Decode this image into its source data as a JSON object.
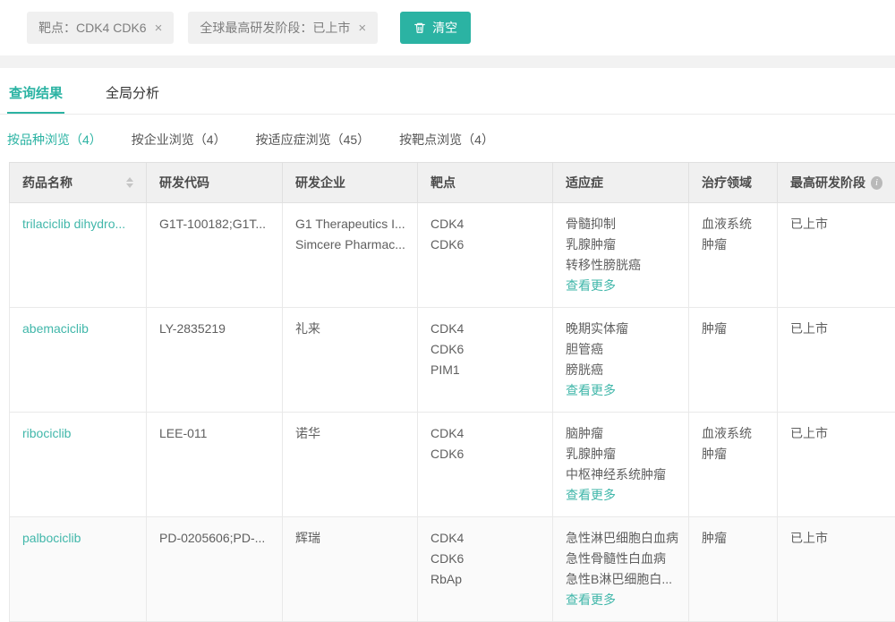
{
  "colors": {
    "accent": "#2bb3a3",
    "link": "#41b7aa",
    "header_bg": "#f0f0f0",
    "chip_bg": "#f0f0f0",
    "band_bg": "#f2f2f2"
  },
  "icons": {
    "close_icon": "×",
    "info_glyph": "i"
  },
  "labels": {
    "view_more": "查看更多"
  },
  "filter_bar": {
    "chips": [
      {
        "label": "靶点：CDK4 CDK6"
      },
      {
        "label": "全球最高研发阶段：已上市"
      }
    ],
    "clear_button": "清空"
  },
  "tabs": [
    {
      "label": "查询结果",
      "active": true
    },
    {
      "label": "全局分析",
      "active": false
    }
  ],
  "subtabs": [
    {
      "label": "按品种浏览（4）",
      "active": true
    },
    {
      "label": "按企业浏览（4）",
      "active": false
    },
    {
      "label": "按适应症浏览（45）",
      "active": false
    },
    {
      "label": "按靶点浏览（4）",
      "active": false
    }
  ],
  "table": {
    "headers": [
      "药品名称",
      "研发代码",
      "研发企业",
      "靶点",
      "适应症",
      "治疗领域",
      "最高研发阶段"
    ],
    "rows": [
      {
        "drug_name": "trilaciclib dihydro...",
        "code": "G1T-100182;G1T...",
        "companies": [
          "G1 Therapeutics I...",
          "Simcere Pharmac..."
        ],
        "targets": [
          "CDK4",
          "CDK6"
        ],
        "indications": [
          "骨髓抑制",
          "乳腺肿瘤",
          "转移性膀胱癌"
        ],
        "areas": [
          "血液系统",
          "肿瘤"
        ],
        "stage": "已上市"
      },
      {
        "drug_name": "abemaciclib",
        "code": "LY-2835219",
        "companies": [
          "礼来"
        ],
        "targets": [
          "CDK4",
          "CDK6",
          "PIM1"
        ],
        "indications": [
          "晚期实体瘤",
          "胆管癌",
          "膀胱癌"
        ],
        "areas": [
          "肿瘤"
        ],
        "stage": "已上市"
      },
      {
        "drug_name": "ribociclib",
        "code": "LEE-011",
        "companies": [
          "诺华"
        ],
        "targets": [
          "CDK4",
          "CDK6"
        ],
        "indications": [
          "脑肿瘤",
          "乳腺肿瘤",
          "中枢神经系统肿瘤"
        ],
        "areas": [
          "血液系统",
          "肿瘤"
        ],
        "stage": "已上市"
      },
      {
        "drug_name": "palbociclib",
        "code": "PD-0205606;PD-...",
        "companies": [
          "辉瑞"
        ],
        "targets": [
          "CDK4",
          "CDK6",
          "RbAp"
        ],
        "indications": [
          "急性淋巴细胞白血病",
          "急性骨髓性白血病",
          "急性B淋巴细胞白..."
        ],
        "areas": [
          "肿瘤"
        ],
        "stage": "已上市"
      }
    ]
  }
}
